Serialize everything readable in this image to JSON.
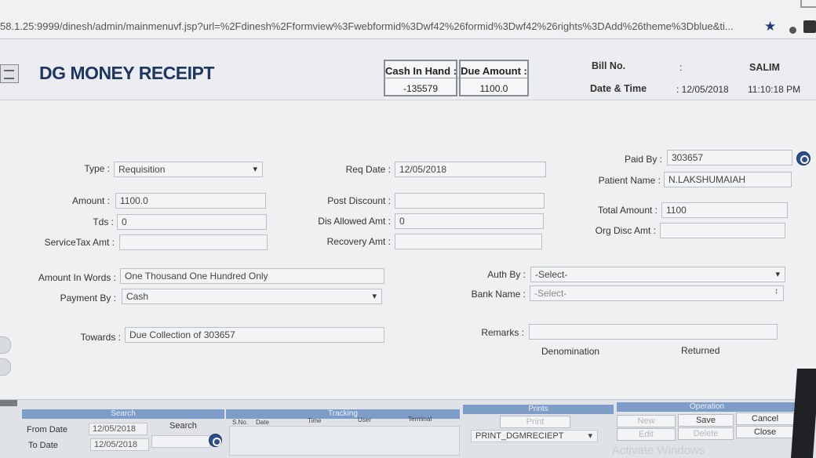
{
  "browser": {
    "url": "58.1.25:9999/dinesh/admin/mainmenuvf.jsp?url=%2Fdinesh%2Fformview%3Fwebformid%3Dwf42%26formid%3Dwf42%26rights%3DAdd%26theme%3Dblue&ti..."
  },
  "header": {
    "title": "DG MONEY RECEIPT",
    "cash_in_hand_label": "Cash In Hand :",
    "cash_in_hand_value": "-135579",
    "due_amount_label": "Due Amount :",
    "due_amount_value": "1100.0",
    "bill_no_label": "Bill No.",
    "bill_no_colon": ":",
    "user": "SALIM",
    "date_time_label": "Date & Time",
    "date": ": 12/05/2018",
    "time": "11:10:18 PM"
  },
  "form": {
    "type_label": "Type :",
    "type_value": "Requisition",
    "req_date_label": "Req Date :",
    "req_date_value": "12/05/2018",
    "paid_by_label": "Paid By :",
    "paid_by_value": "303657",
    "patient_name_label": "Patient Name :",
    "patient_name_value": "N.LAKSHUMAIAH",
    "amount_label": "Amount :",
    "amount_value": "1100.0",
    "post_discount_label": "Post Discount :",
    "post_discount_value": "",
    "tds_label": "Tds :",
    "tds_value": "0",
    "dis_allowed_label": "Dis Allowed Amt :",
    "dis_allowed_value": "0",
    "total_amount_label": "Total Amount :",
    "total_amount_value": "1100",
    "org_disc_label": "Org Disc Amt :",
    "org_disc_value": "",
    "servicetax_label": "ServiceTax Amt :",
    "servicetax_value": "",
    "recovery_label": "Recovery Amt :",
    "recovery_value": "",
    "amount_words_label": "Amount In Words :",
    "amount_words_value": "One Thousand One Hundred Only",
    "auth_by_label": "Auth By :",
    "auth_by_value": "-Select-",
    "payment_by_label": "Payment By :",
    "payment_by_value": "Cash",
    "bank_name_label": "Bank Name :",
    "bank_name_value": "-Select-",
    "towards_label": "Towards :",
    "towards_value": "Due Collection of 303657",
    "remarks_label": "Remarks :",
    "remarks_value": "",
    "denomination_label": "Denomination",
    "returned_label": "Returned"
  },
  "bottom": {
    "search_header": "Search",
    "from_date_label": "From Date",
    "from_date_value": "12/05/2018",
    "to_date_label": "To Date",
    "to_date_value": "12/05/2018",
    "search_label": "Search",
    "tracking_header": "Tracking",
    "col_sno": "S.No.",
    "col_date": "Date",
    "col_time": "Time",
    "col_user": "User",
    "col_terminal": "Terminal",
    "prints_header": "Prints",
    "print_button": "Print",
    "print_select": "PRINT_DGMRECIEPT",
    "operation_header": "Operation",
    "new_button": "New",
    "save_button": "Save",
    "cancel_button": "Cancel",
    "edit_button": "Edit",
    "delete_button": "Delete",
    "close_button": "Close",
    "watermark": "Activate Windows"
  }
}
